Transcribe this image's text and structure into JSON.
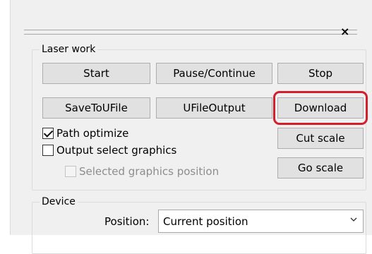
{
  "window": {
    "close_glyph": "×"
  },
  "laser_work": {
    "legend": "Laser work",
    "buttons": {
      "start": "Start",
      "pause_continue": "Pause/Continue",
      "stop": "Stop",
      "save_to_ufile": "SaveToUFile",
      "ufile_output": "UFileOutput",
      "download": "Download",
      "cut_scale": "Cut scale",
      "go_scale": "Go scale"
    },
    "options": {
      "path_optimize": {
        "label": "Path optimize",
        "checked": true
      },
      "output_select_graphics": {
        "label": "Output select graphics",
        "checked": false
      },
      "selected_graphics_position": {
        "label": "Selected graphics position",
        "checked": false,
        "enabled": false
      }
    }
  },
  "device": {
    "legend": "Device",
    "position_label": "Position:",
    "position_value": "Current position"
  },
  "colors": {
    "highlight": "#d21f2b",
    "button_face": "#e1e1e1",
    "panel": "#f0f0f0"
  }
}
